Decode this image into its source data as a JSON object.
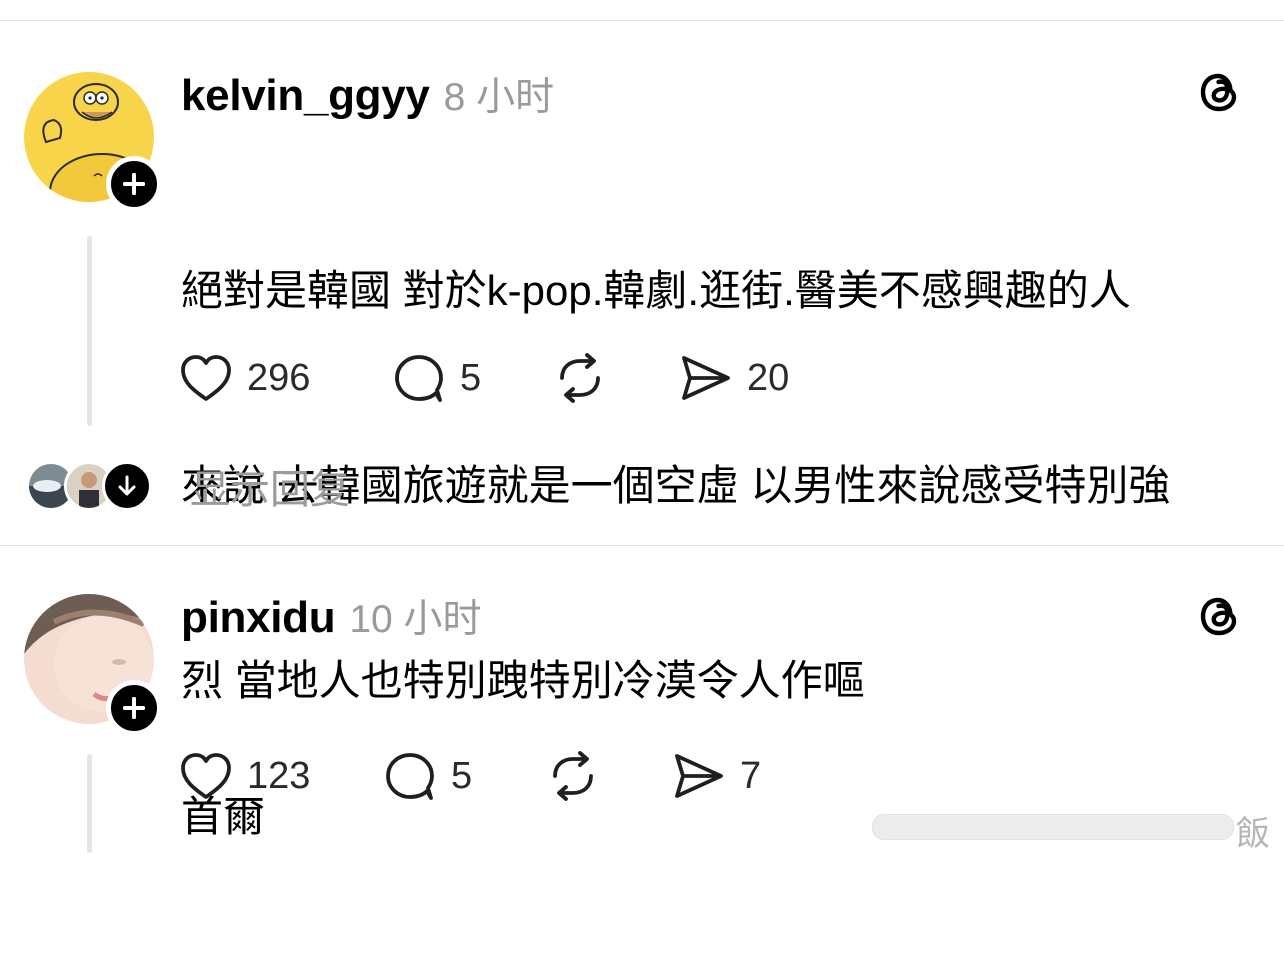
{
  "posts": [
    {
      "username": "kelvin_ggyy",
      "time": "8 小时",
      "text_lines": [
        "絕對是韓國 對於k-pop.韓劇.逛街.醫美不感興趣的人",
        "來說 去韓國旅遊就是一個空虛 以男性來說感受特別強",
        "烈 當地人也特別跩特別冷漠令人作嘔"
      ],
      "likes": "296",
      "comments": "5",
      "shares": "20",
      "show_replies": "显示回复"
    },
    {
      "username": "pinxidu",
      "time": "10 小时",
      "text_lines": [
        "首爾"
      ],
      "likes": "123",
      "comments": "5",
      "shares": "7"
    }
  ],
  "watermark": {
    "text": "飯"
  },
  "icons": {
    "app_logo": "threads-logo-icon",
    "follow": "plus-icon",
    "like": "heart-icon",
    "comment": "comment-bubble-icon",
    "repost": "repost-icon",
    "share": "send-icon",
    "expand": "arrow-down-icon"
  },
  "colors": {
    "text": "#000000",
    "muted": "#9a9a9a",
    "divider": "#e3e3e3",
    "thread_line": "#e5e5e5",
    "badge": "#000000"
  }
}
